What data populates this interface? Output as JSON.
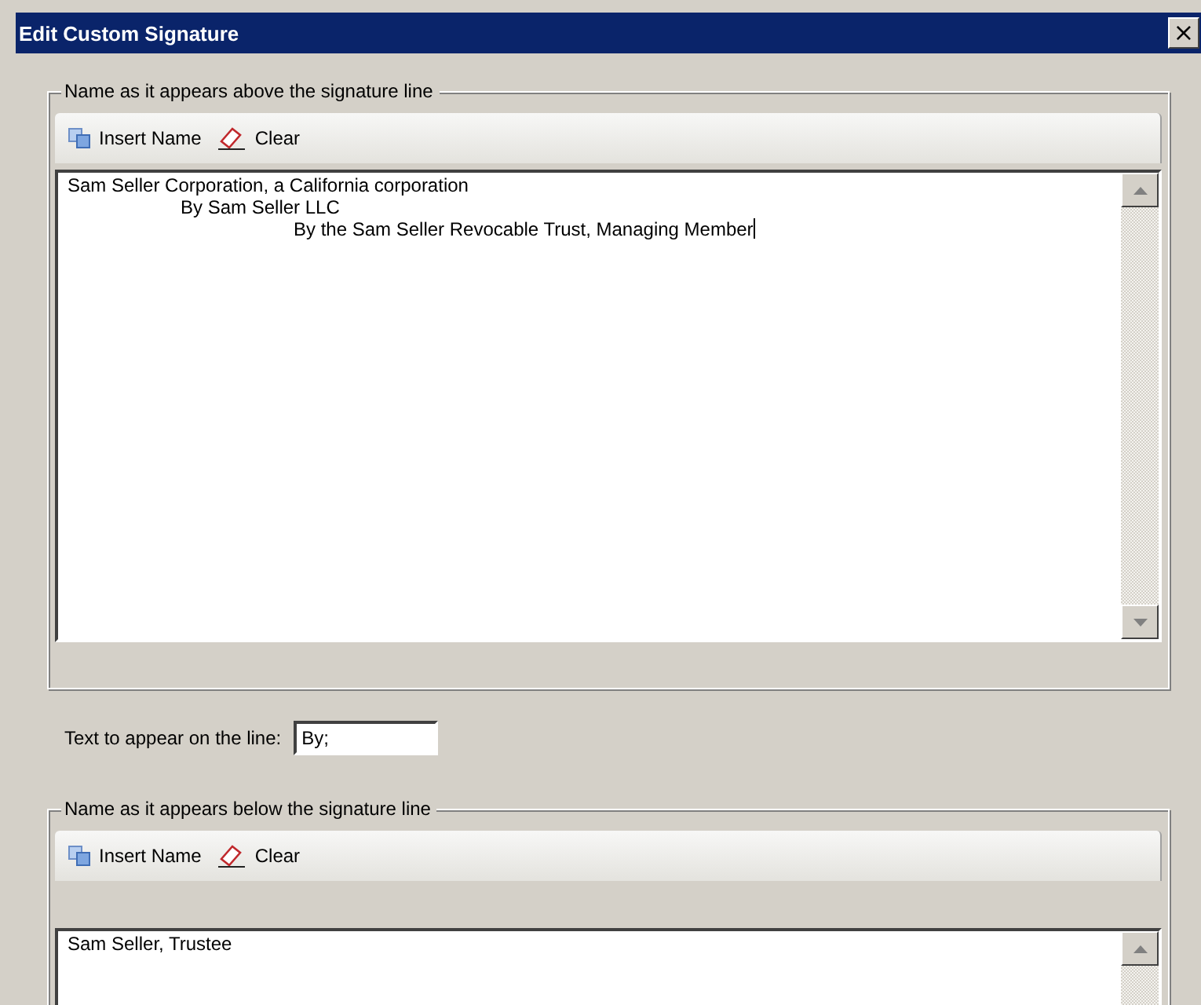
{
  "window": {
    "title": "Edit Custom Signature",
    "close": "×"
  },
  "above": {
    "legend": "Name as it appears above the signature line",
    "toolbar": [
      {
        "kind": "insert",
        "label": "Insert Name"
      },
      {
        "kind": "clear",
        "label": "Clear"
      }
    ],
    "text": "Sam Seller Corporation, a California corporation\n\t\tBy Sam Seller LLC\n\t\t\t\tBy the Sam Seller Revocable Trust, Managing Member",
    "focused": true
  },
  "line": {
    "label": "Text to appear on the line:",
    "value": "By;"
  },
  "below": {
    "legend": "Name as it appears below the signature line",
    "toolbar": [
      {
        "kind": "insert",
        "label": "Insert Name"
      },
      {
        "kind": "clear",
        "label": "Clear"
      }
    ],
    "text": "Sam Seller, Trustee",
    "focused": false
  }
}
